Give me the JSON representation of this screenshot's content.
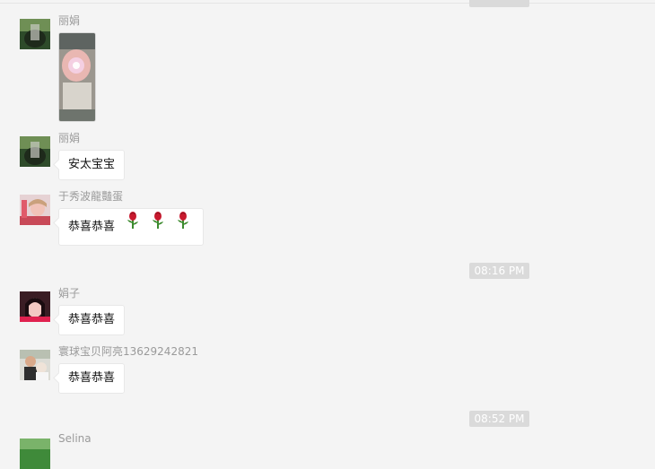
{
  "time_chips": [
    "08:16 PM",
    "08:52 PM"
  ],
  "messages": [
    {
      "name": "丽娟",
      "type": "image"
    },
    {
      "name": "丽娟",
      "text": "安太宝宝"
    },
    {
      "name": "于秀波龍豔蛋",
      "text": "恭喜恭喜",
      "emoji": [
        "rose-icon",
        "rose-icon",
        "rose-icon"
      ]
    },
    {
      "name": "娟子",
      "text": "恭喜恭喜"
    },
    {
      "name": "寰球宝贝阿亮13629242821",
      "text": "恭喜恭喜"
    },
    {
      "name": "Selina"
    }
  ],
  "colors": {
    "background": "#f4f4f4",
    "bubble": "#ffffff",
    "time_chip": "#dadada"
  }
}
